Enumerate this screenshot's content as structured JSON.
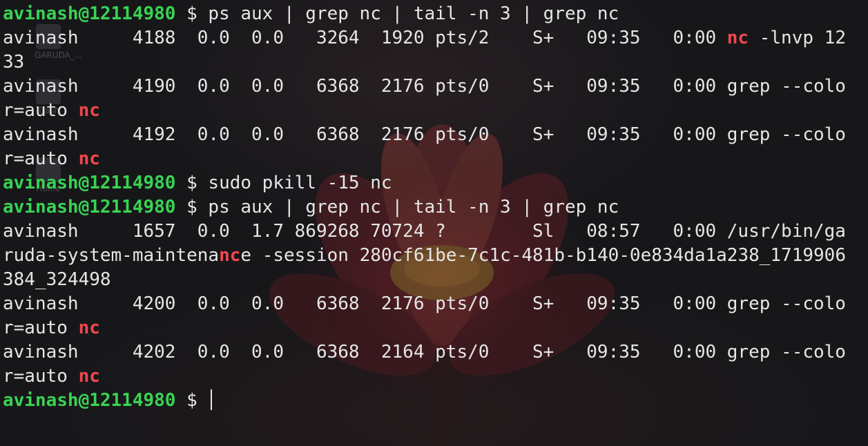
{
  "desktop": {
    "icons": [
      {
        "name": "file-icon",
        "label": "GARUDA_..."
      },
      {
        "name": "trash-icon",
        "label": "Trash"
      },
      {
        "name": "home-icon",
        "label": "Home"
      }
    ]
  },
  "terminal": {
    "prompt_user": "avinash@12114980",
    "colors": {
      "prompt": "#39d353",
      "match": "#f0484b",
      "text": "#e6e6e6"
    },
    "cmd1": " $ ps aux | grep nc | tail -n 3 | grep nc",
    "l1a": "avinash     4188  0.0  0.0   3264  1920 pts/2    S+   09:35   0:00 ",
    "l1b": "nc",
    "l1c": " -lnvp 12",
    "l2": "33",
    "l3": "avinash     4190  0.0  0.0   6368  2176 pts/0    S+   09:35   0:00 grep --colo",
    "l4a": "r=auto ",
    "l4b": "nc",
    "l5": "avinash     4192  0.0  0.0   6368  2176 pts/0    S+   09:35   0:00 grep --colo",
    "l6a": "r=auto ",
    "l6b": "nc",
    "cmd2": " $ sudo pkill -15 nc",
    "cmd3": " $ ps aux | grep nc | tail -n 3 | grep nc",
    "l9": "avinash     1657  0.0  1.7 869268 70724 ?        Sl   08:57   0:00 /usr/bin/ga",
    "l10a": "ruda-system-maintena",
    "l10b": "nc",
    "l10c": "e -session 280cf61be-7c1c-481b-b140-0e834da1a238_1719906",
    "l11": "384_324498",
    "l12": "avinash     4200  0.0  0.0   6368  2176 pts/0    S+   09:35   0:00 grep --colo",
    "l13a": "r=auto ",
    "l13b": "nc",
    "l14": "avinash     4202  0.0  0.0   6368  2164 pts/0    S+   09:35   0:00 grep --colo",
    "l15a": "r=auto ",
    "l15b": "nc",
    "cmd4": " $ "
  }
}
